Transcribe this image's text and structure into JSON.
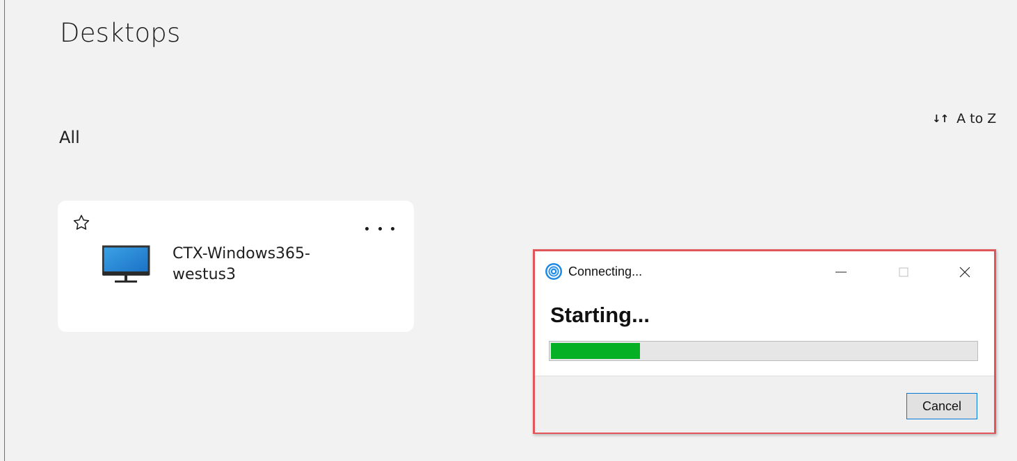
{
  "header": {
    "title": "Desktops"
  },
  "section": {
    "title": "All"
  },
  "sort": {
    "label": "A to Z",
    "icon": "sort-arrows-icon"
  },
  "desktops": [
    {
      "name_line1": "CTX-Windows365-",
      "name_line2": "westus3",
      "icon": "monitor-icon",
      "favorite_icon": "star-outline-icon",
      "more_icon": "ellipsis-icon"
    }
  ],
  "dialog": {
    "title": "Connecting...",
    "status": "Starting...",
    "progress_fraction": 0.21,
    "cancel_label": "Cancel",
    "colors": {
      "highlight_border": "#e15759",
      "progress": "#06b025",
      "button_focus": "#0078d7"
    }
  }
}
